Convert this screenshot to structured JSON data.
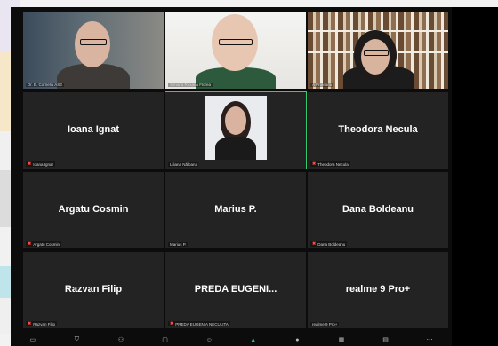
{
  "participants": [
    {
      "id": "p1",
      "name": "Ioana Ignat",
      "label": "Ioana Ignat"
    },
    {
      "id": "p2",
      "name": "Theodora Necula",
      "label": "Theodora Necula"
    },
    {
      "id": "p3",
      "name": "Argatu Cosmin",
      "label": "Argatu Cosmin"
    },
    {
      "id": "p4",
      "name": "Marius P.",
      "label": "Marius P."
    },
    {
      "id": "p5",
      "name": "Dana Boldeanu",
      "label": "Dana Boldeanu"
    },
    {
      "id": "p6",
      "name": "Razvan Filip",
      "label": "Razvan Filip"
    },
    {
      "id": "p7",
      "name": "PREDA  EUGENI...",
      "label": "PREDA EUGENIA NECULITA"
    },
    {
      "id": "p8",
      "name": "realme 9 Pro+",
      "label": "realme 9 Pro+"
    }
  ],
  "video_tiles": [
    {
      "id": "v1",
      "label": "Dr. E. Corneliu ASE"
    },
    {
      "id": "v2",
      "label": "Simona Roxana Florea"
    },
    {
      "id": "v3",
      "label": "A Pruteanu"
    },
    {
      "id": "v4",
      "label": "Liliana Nălbaru"
    }
  ],
  "icons": {
    "mute": "muted-mic-icon",
    "camera": "camera-icon",
    "security": "shield-icon",
    "participants": "participants-icon",
    "chat": "chat-icon",
    "share": "share-screen-icon",
    "record": "record-icon",
    "reactions": "reactions-icon",
    "apps": "apps-icon",
    "whiteboard": "whiteboard-icon",
    "more": "more-icon"
  },
  "colors": {
    "window_bg": "#0c0c0c",
    "tile_bg": "#232323",
    "active_speaker": "#2fd16e",
    "muted": "#ff4a4a",
    "share_green": "#1ec26a"
  }
}
